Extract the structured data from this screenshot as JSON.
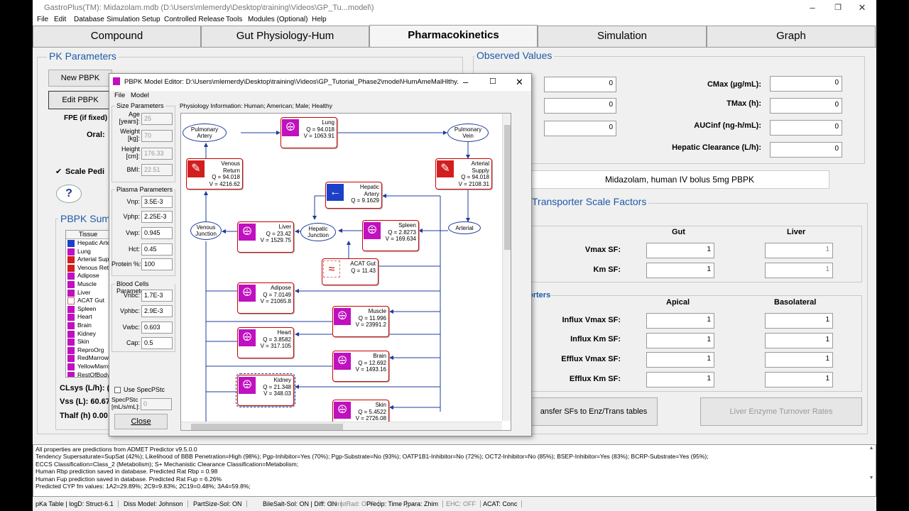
{
  "window": {
    "title": "GastroPlus(TM): Midazolam.mdb (D:\\Users\\mlemerdy\\Desktop\\training\\Videos\\GP_Tu...model\\)"
  },
  "menu": [
    "File",
    "Edit",
    "Database",
    "Simulation Setup",
    "Controlled Release",
    "Tools",
    "Modules (Optional)",
    "Help"
  ],
  "tabs": [
    "Compound",
    "Gut Physiology-Hum",
    "Pharmacokinetics",
    "Simulation",
    "Graph"
  ],
  "pk": {
    "title": "PK Parameters",
    "new_pbpk": "New PBPK",
    "edit_pbpk": "Edit PBPK",
    "fpe": "FPE (if fixed) [",
    "oral": "Oral:",
    "scale": "Scale Pedi",
    "help": "?"
  },
  "pbpk_summary": {
    "title": "PBPK Sumi",
    "col": "Tissue",
    "tissues": [
      {
        "n": "Hepatic Arte",
        "c": "blue"
      },
      {
        "n": "Lung",
        "c": "mag"
      },
      {
        "n": "Arterial Supp",
        "c": "red"
      },
      {
        "n": "Venous Ret",
        "c": "red"
      },
      {
        "n": "Adipose",
        "c": "mag"
      },
      {
        "n": "Muscle",
        "c": "mag"
      },
      {
        "n": "Liver",
        "c": "mag"
      },
      {
        "n": "ACAT Gut",
        "c": "gut"
      },
      {
        "n": "Spleen",
        "c": "mag"
      },
      {
        "n": "Heart",
        "c": "mag"
      },
      {
        "n": "Brain",
        "c": "mag"
      },
      {
        "n": "Kidney",
        "c": "mag"
      },
      {
        "n": "Skin",
        "c": "mag"
      },
      {
        "n": "ReproOrg",
        "c": "mag"
      },
      {
        "n": "RedMarrow",
        "c": "mag"
      },
      {
        "n": "YellowMarro",
        "c": "mag"
      },
      {
        "n": "RestOfBody",
        "c": "mag"
      }
    ],
    "clsys": "CLsys (L/h): (",
    "vss": "Vss (L): 60.67",
    "thalf": "Thalf (h) 0.00"
  },
  "observed": {
    "title": "Observed Values",
    "left_vals": [
      "0",
      "0",
      "0"
    ],
    "right": [
      {
        "l": "CMax (µg/mL):",
        "v": "0"
      },
      {
        "l": "TMax (h):",
        "v": "0"
      },
      {
        "l": "AUCinf (ng-h/mL):",
        "v": "0"
      },
      {
        "l": "Hepatic Clearance (L/h):",
        "v": "0"
      }
    ]
  },
  "description": "Midazolam, human IV bolus 5mg PBPK",
  "transporter": {
    "title": "Transporter Scale Factors",
    "gut": "Gut",
    "liver": "Liver",
    "rows": [
      {
        "l": "Vmax SF:",
        "g": "1",
        "lv": "1"
      },
      {
        "l": "Km SF:",
        "g": "1",
        "lv": "1"
      }
    ],
    "sub": "orters",
    "apical": "Apical",
    "basolateral": "Basolateral",
    "rows2": [
      {
        "l": "Influx Vmax SF:",
        "a": "1",
        "b": "1"
      },
      {
        "l": "Influx Km SF:",
        "a": "1",
        "b": "1"
      },
      {
        "l": "Efflux Vmax SF:",
        "a": "1",
        "b": "1"
      },
      {
        "l": "Efflux Km SF:",
        "a": "1",
        "b": "1"
      }
    ],
    "btn1": "ansfer SFs to Enz/Trans tables",
    "btn2": "Liver Enzyme Turnover Rates"
  },
  "log": [
    "All properties are predictions from ADMET Predictor v9.5.0.0",
    "Tendency Supersaturate=SupSat (42%); Likelihood of BBB Penetration=High (98%); Pgp-Inhibitor=Yes (70%); Pgp-Substrate=No (93%); OATP1B1-Inhibitor=No (72%); OCT2-Inhibitor=No (85%); BSEP-Inhibitor=Yes (83%); BCRP-Substrate=Yes (95%);",
    "ECCS Classification=Class_2 (Metabolism); S+ Mechanistic Clearance Classification=Metabolism;",
    "Human Rbp prediction saved in database. Predicted Rat Rbp = 0.98",
    "Human Fup prediction saved in database. Predicted Rat Fup = 6.26%",
    "Predicted CYP fm values: 1A2=29.89%; 2C9=9.83%; 2C19=0.48%; 3A4=59.8%;"
  ],
  "status": [
    {
      "t": "pKa Table | logD: Struct-6.1",
      "d": false
    },
    {
      "t": "Diss Model: Johnson",
      "d": false
    },
    {
      "t": "PartSize-Sol: ON",
      "d": false
    },
    {
      "t": "BileSalt-Sol: ON | Diff: ON",
      "d": false
    },
    {
      "t": "ConstRad: OFF",
      "d": true
    },
    {
      "t": "Precip: Time",
      "d": false
    },
    {
      "t": "Ppara: Zhim",
      "d": false
    },
    {
      "t": "EHC: OFF",
      "d": true
    },
    {
      "t": "ACAT: Conc",
      "d": false
    }
  ],
  "dialog": {
    "title": "PBPK Model Editor: D:\\Users\\mlemerdy\\Desktop\\training\\Videos\\GP_Tutorial_Phase2\\model\\HumAmeMalHlthy...",
    "menu": [
      "File",
      "Model"
    ],
    "physio": "Physiology Information: Human;  American;  Male;  Healthy",
    "size": {
      "h": "Size Parameters",
      "rows": [
        {
          "l": "Age\n[years]:",
          "v": "25"
        },
        {
          "l": "Weight\n[kg]:",
          "v": "70"
        },
        {
          "l": "Height\n[cm]:",
          "v": "176.33"
        },
        {
          "l": "BMI:",
          "v": "22.51"
        }
      ]
    },
    "plasma": {
      "h": "Plasma Parameters",
      "rows": [
        {
          "l": "Vnp:",
          "v": "3.5E-3"
        },
        {
          "l": "Vphp:",
          "v": "2.25E-3"
        },
        {
          "l": "Vwp:",
          "v": "0.945"
        },
        {
          "l": "Hct:",
          "v": "0.45"
        },
        {
          "l": "Protein %:",
          "v": "100"
        }
      ]
    },
    "blood": {
      "h": "Blood Cells Parameters",
      "rows": [
        {
          "l": "Vnbc:",
          "v": "1.7E-3"
        },
        {
          "l": "Vphbc:",
          "v": "2.9E-3"
        },
        {
          "l": "Vwbc:",
          "v": "0.603"
        },
        {
          "l": "Cap:",
          "v": "0.5"
        }
      ]
    },
    "use_specpstc": "Use SpecPStc",
    "specpstc_l": "SpecPStc\n[mL/s/mL]:",
    "specpstc_v": "0",
    "close": "Close",
    "nodes": {
      "lung": [
        "Lung",
        "Q = 94.018",
        "V = 1063.91"
      ],
      "venous": [
        "Venous Return",
        "Q = 94.018",
        "V = 4216.62"
      ],
      "arterial": [
        "Arterial Supply",
        "Q = 94.018",
        "V = 2108.31"
      ],
      "hepart": [
        "Hepatic Artery",
        "Q = 9.1629"
      ],
      "liver": [
        "Liver",
        "Q = 23.42",
        "V = 1529.75"
      ],
      "spleen": [
        "Spleen",
        "Q = 2.8273",
        "V = 169.634"
      ],
      "acat": [
        "ACAT Gut",
        "Q = 11.43"
      ],
      "adipose": [
        "Adipose",
        "Q = 7.0149",
        "V = 21065.8"
      ],
      "muscle": [
        "Muscle",
        "Q = 11.996",
        "V = 23991.2"
      ],
      "heart": [
        "Heart",
        "Q = 3.8582",
        "V = 317.105"
      ],
      "brain": [
        "Brain",
        "Q = 12.692",
        "V = 1493.16"
      ],
      "kidney": [
        "Kidney",
        "Q = 21.348",
        "V = 348.03"
      ],
      "skin": [
        "Skin",
        "Q = 5.4522",
        "V = 2726.08"
      ]
    },
    "ovals": {
      "pa": "Pulmonary\nArtery",
      "pv": "Pulmonary\nVein",
      "vj": "Venous\nJunction",
      "hj": "Hepatic\nJunction",
      "art": "Arterial"
    }
  }
}
